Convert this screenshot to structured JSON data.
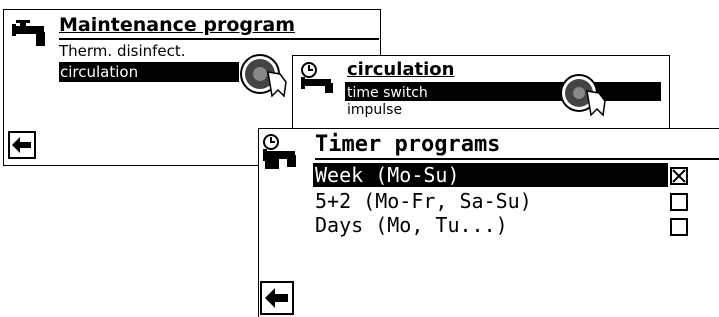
{
  "screen1": {
    "title": "Maintenance program",
    "items": [
      {
        "label": "Therm. disinfect.",
        "selected": false
      },
      {
        "label": "circulation",
        "selected": true
      }
    ],
    "icon": "faucet-icon",
    "back_icon": "back-arrow-icon"
  },
  "screen2": {
    "title": "circulation",
    "items": [
      {
        "label": "time switch",
        "selected": true
      },
      {
        "label": "impulse",
        "selected": false
      }
    ],
    "icon": "clock-faucet-icon"
  },
  "screen3": {
    "title": "Timer programs",
    "items": [
      {
        "label": "Week (Mo-Su)",
        "selected": true,
        "checked": true
      },
      {
        "label": "5+2 (Mo-Fr, Sa-Su)",
        "selected": false,
        "checked": false
      },
      {
        "label": "Days (Mo, Tu...)",
        "selected": false,
        "checked": false
      }
    ],
    "icon": "clock-faucet-icon",
    "back_icon": "back-arrow-icon"
  },
  "colors": {
    "foreground": "#000000",
    "background": "#ffffff"
  }
}
